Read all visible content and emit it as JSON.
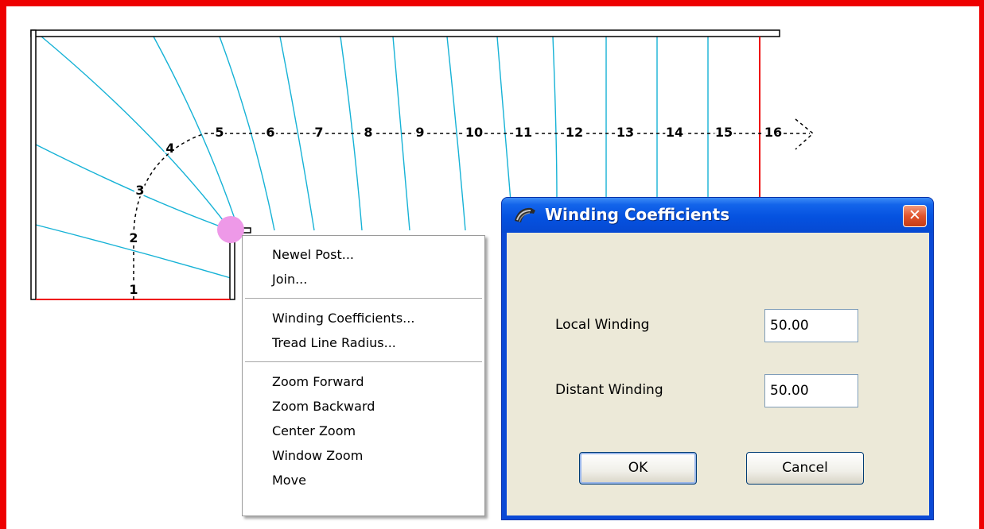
{
  "stair_plan": {
    "step_numbers": [
      "1",
      "2",
      "3",
      "4",
      "5",
      "6",
      "7",
      "8",
      "9",
      "10",
      "11",
      "12",
      "13",
      "14",
      "15",
      "16"
    ],
    "colors": {
      "tread_lines": "#16b2d6",
      "boundary_lines": "#ee0000",
      "walk_line": "#000000",
      "newel_highlight": "#ee99e8"
    }
  },
  "context_menu": {
    "groups": [
      [
        "Newel Post...",
        "Join..."
      ],
      [
        "Winding Coefficients...",
        "Tread Line Radius..."
      ],
      [
        "Zoom Forward",
        "Zoom Backward",
        "Center Zoom",
        "Window Zoom",
        "Move"
      ]
    ]
  },
  "dialog": {
    "title": "Winding Coefficients",
    "close_glyph": "✕",
    "local_winding_label": "Local Winding",
    "local_winding_value": "50.00",
    "distant_winding_label": "Distant Winding",
    "distant_winding_value": "50.00",
    "ok_label": "OK",
    "cancel_label": "Cancel"
  }
}
